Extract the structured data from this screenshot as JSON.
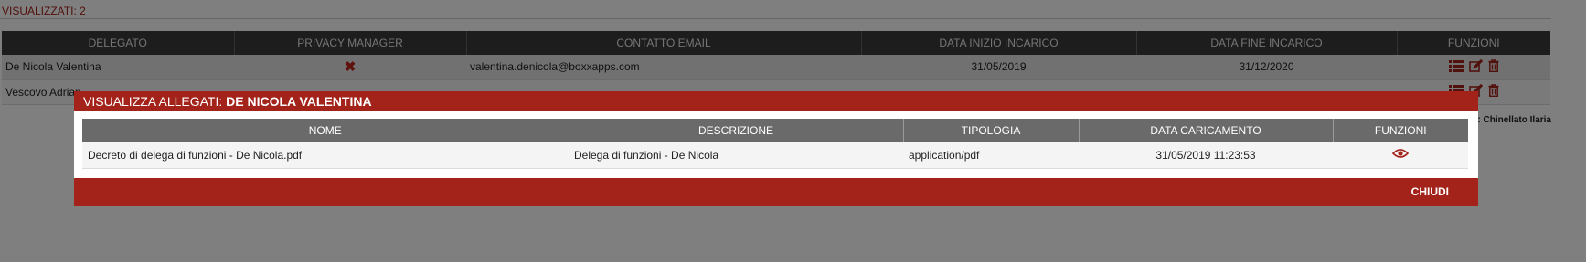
{
  "list": {
    "count_label": "VISUALIZZATI: 2",
    "columns": [
      "DELEGATO",
      "PRIVACY MANAGER",
      "CONTATTO EMAIL",
      "DATA INIZIO INCARICO",
      "DATA FINE INCARICO",
      "FUNZIONI"
    ],
    "rows": [
      {
        "delegato": "De Nicola Valentina",
        "email": "valentina.denicola@boxxapps.com",
        "start": "31/05/2019",
        "end": "31/12/2020"
      },
      {
        "delegato": "Vescovo Adrian",
        "email": "",
        "start": "",
        "end": ""
      }
    ],
    "footer_note": "a: Chinellato Ilaria"
  },
  "modal": {
    "title_prefix": "VISUALIZZA ALLEGATI:",
    "title_name": "DE NICOLA VALENTINA",
    "columns": [
      "NOME",
      "DESCRIZIONE",
      "TIPOLOGIA",
      "DATA CARICAMENTO",
      "FUNZIONI"
    ],
    "rows": [
      {
        "nome": "Decreto di delega di funzioni - De Nicola.pdf",
        "descrizione": "Delega di funzioni - De Nicola",
        "tipologia": "application/pdf",
        "data": "31/05/2019 11:23:53"
      }
    ],
    "close_label": "CHIUDI"
  },
  "colors": {
    "accent": "#a3231b",
    "header_dark": "#3b3b3b",
    "header_mid": "#6a6a6a"
  }
}
